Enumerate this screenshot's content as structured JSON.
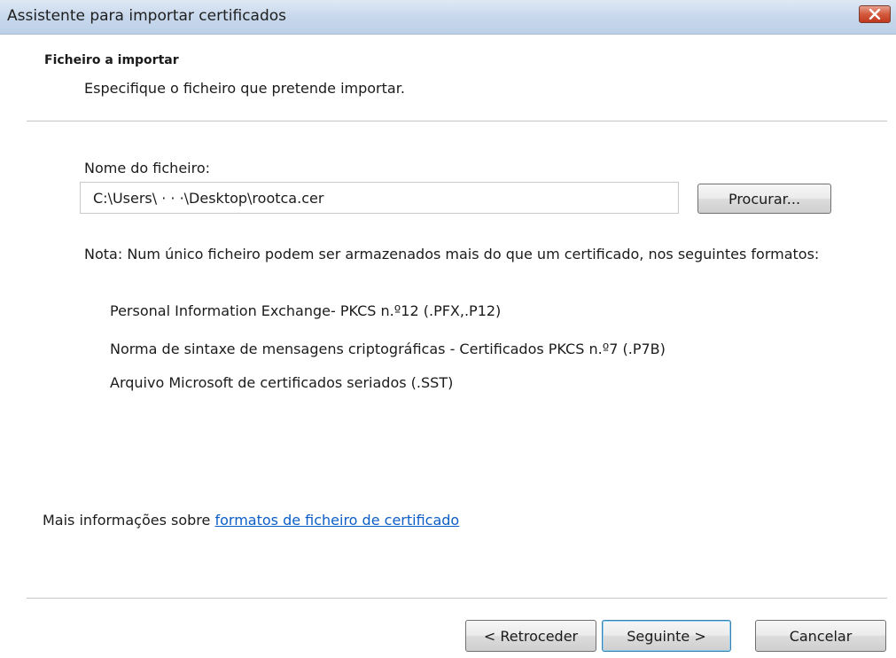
{
  "window": {
    "title": "Assistente para importar certificados",
    "close_icon": "close-icon"
  },
  "header": {
    "title": "Ficheiro a importar",
    "description": "Especifique o ficheiro que pretende importar."
  },
  "file": {
    "label": "Nome do ficheiro:",
    "value": "C:\\Users\\ · · ·\\Desktop\\rootca.cer",
    "browse_label": "Procurar..."
  },
  "note": {
    "text": "Nota: Num único ficheiro podem ser armazenados mais do que um certificado, nos seguintes formatos:",
    "formats": [
      "Personal Information Exchange- PKCS n.º12 (.PFX,.P12)",
      "Norma de sintaxe de mensagens criptográficas - Certificados PKCS n.º7 (.P7B)",
      "Arquivo Microsoft de certificados seriados (.SST)"
    ]
  },
  "more_info": {
    "prefix": "Mais informações sobre ",
    "link": "formatos de ficheiro de certificado"
  },
  "footer": {
    "back_label": "< Retroceder",
    "next_label": "Seguinte >",
    "cancel_label": "Cancelar"
  },
  "colors": {
    "link": "#0c5ec6",
    "title_bar": "#c9d9ec",
    "close_button": "#c0391d"
  }
}
